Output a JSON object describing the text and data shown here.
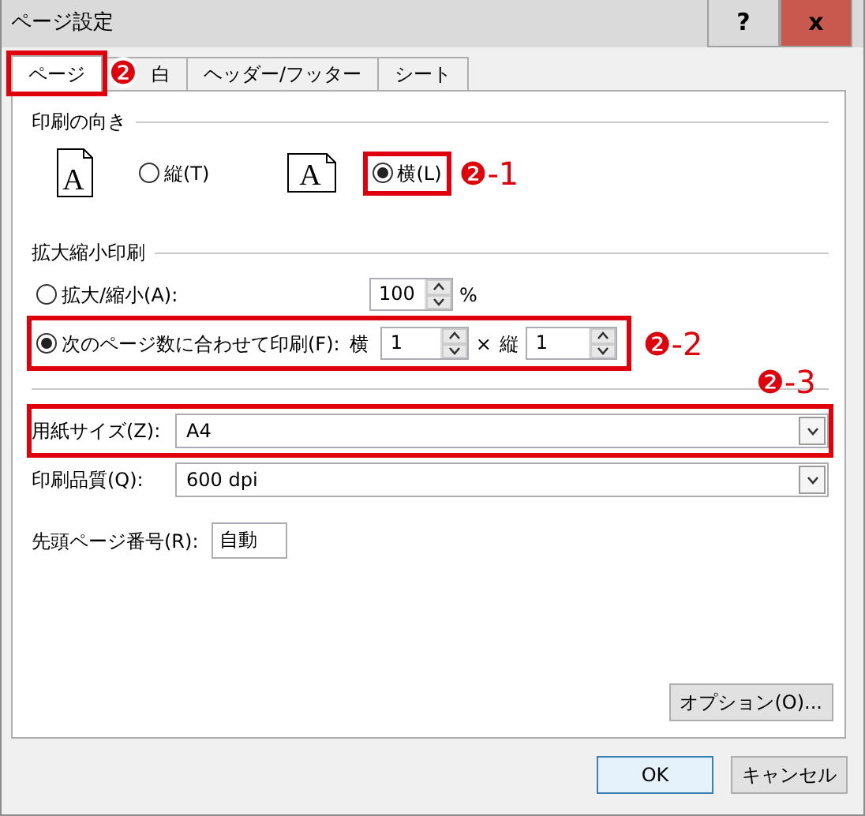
{
  "window": {
    "title": "ページ設定",
    "help": "?",
    "close": "x"
  },
  "tabs": [
    {
      "label": "ページ",
      "selected": true
    },
    {
      "label": "白",
      "selected": false
    },
    {
      "label": "ヘッダー/フッター",
      "selected": false
    },
    {
      "label": "シート",
      "selected": false
    }
  ],
  "orientation": {
    "heading": "印刷の向き",
    "options": [
      {
        "label": "縦(T)",
        "selected": false,
        "icon_text": "A",
        "kind": "portrait"
      },
      {
        "label": "横(L)",
        "selected": true,
        "icon_text": "A",
        "kind": "landscape"
      }
    ]
  },
  "scaling": {
    "heading": "拡大縮小印刷",
    "options": [
      {
        "label": "拡大/縮小(A):",
        "selected": false
      },
      {
        "label": "次のページ数に合わせて印刷(F):",
        "selected": true
      }
    ],
    "percent": {
      "value": "100",
      "unit": "%"
    },
    "fit": {
      "wide_label": "横",
      "wide": "1",
      "times": "×",
      "tall_label": "縦",
      "tall": "1"
    }
  },
  "paper_size": {
    "label": "用紙サイズ(Z):",
    "value": "A4"
  },
  "print_quality": {
    "label": "印刷品質(Q):",
    "value": "600 dpi"
  },
  "first_page_number": {
    "label": "先頭ページ番号(R):",
    "value": "自動"
  },
  "options_button": "オプション(O)...",
  "buttons": [
    {
      "label": "OK",
      "default": true
    },
    {
      "label": "キャンセル",
      "default": false
    }
  ],
  "annotations": [
    {
      "label": "❷"
    },
    {
      "label": "❷-1"
    },
    {
      "label": "❷-2"
    },
    {
      "label": "❷-3"
    }
  ]
}
